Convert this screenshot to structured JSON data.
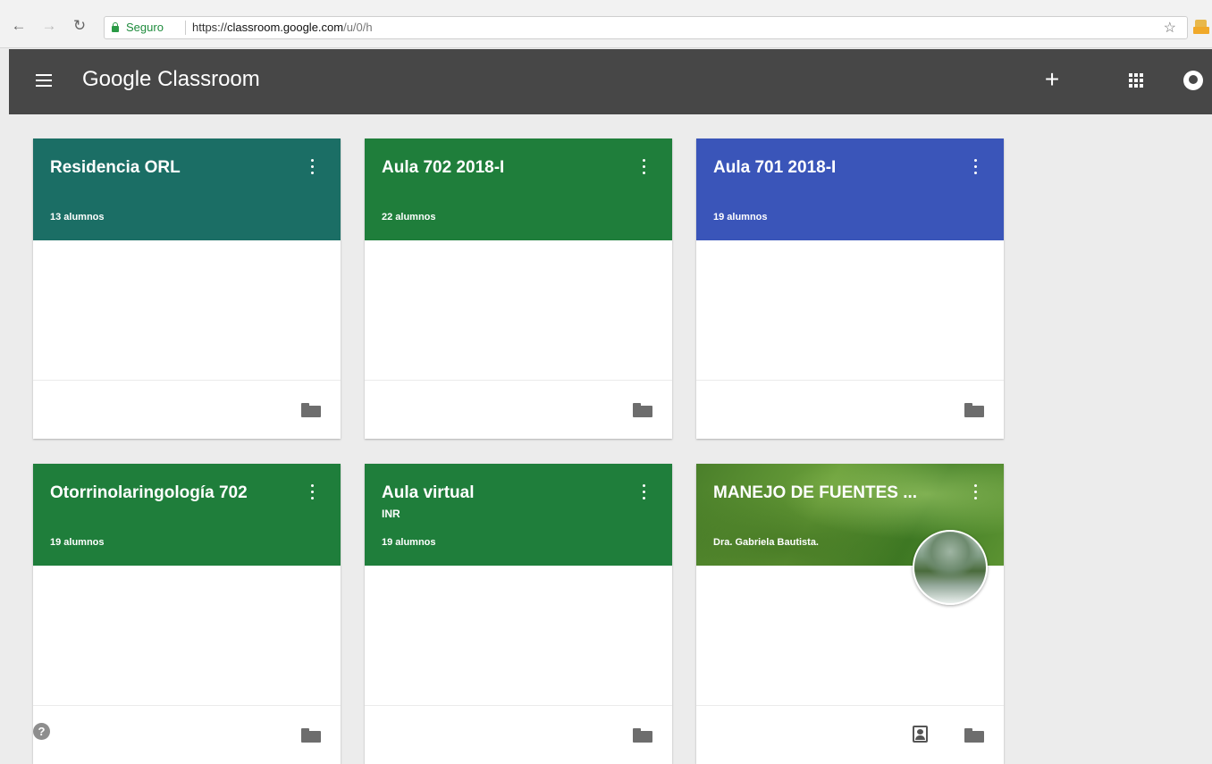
{
  "browser": {
    "back_icon": "back-arrow-icon",
    "forward_icon": "forward-arrow-icon",
    "reload_icon": "reload-icon",
    "secure_label": "Seguro",
    "url_scheme": "https://",
    "url_host": "classroom.google.com",
    "url_path": "/u/0/h"
  },
  "appbar": {
    "title_brand": "Google",
    "title_product": "Classroom",
    "color": "#474747"
  },
  "courses": [
    {
      "title": "Residencia ORL",
      "section": "",
      "count": "13 alumnos",
      "color": "#1b6e65",
      "teacher": ""
    },
    {
      "title": "Aula 702 2018-I",
      "section": "",
      "count": "22 alumnos",
      "color": "#1f7e3b",
      "teacher": ""
    },
    {
      "title": "Aula 701 2018-I",
      "section": "",
      "count": "19 alumnos",
      "color": "#3a55b9",
      "teacher": ""
    },
    {
      "title": "Otorrinolaringología 702",
      "section": "",
      "count": "19 alumnos",
      "color": "#1f7e3b",
      "teacher": ""
    },
    {
      "title": "Aula virtual",
      "section": "INR",
      "count": "19 alumnos",
      "color": "#1f7e3b",
      "teacher": ""
    },
    {
      "title": "MANEJO DE FUENTES ...",
      "section": "",
      "count": "Dra. Gabriela Bautista.",
      "color": "#4f862e",
      "teacher": ""
    }
  ]
}
